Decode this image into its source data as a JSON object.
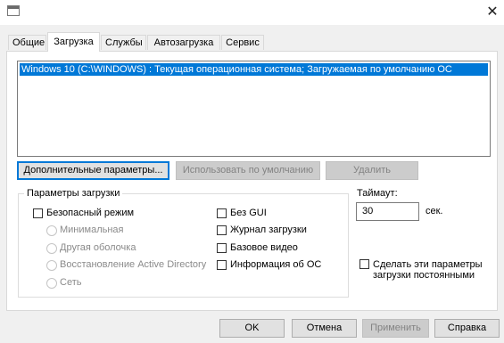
{
  "tabs": [
    {
      "label": "Общие"
    },
    {
      "label": "Загрузка"
    },
    {
      "label": "Службы"
    },
    {
      "label": "Автозагрузка"
    },
    {
      "label": "Сервис"
    }
  ],
  "active_tab": "Загрузка",
  "os_list": {
    "items": [
      "Windows 10 (C:\\WINDOWS) : Текущая операционная система; Загружаемая по умолчанию ОС"
    ],
    "selected_index": 0
  },
  "boot_buttons": {
    "advanced": "Дополнительные параметры...",
    "set_default": "Использовать по умолчанию",
    "delete": "Удалить"
  },
  "boot_options": {
    "title": "Параметры загрузки",
    "safe_boot": {
      "label": "Безопасный режим",
      "checked": false
    },
    "radios": [
      {
        "label": "Минимальная"
      },
      {
        "label": "Другая оболочка"
      },
      {
        "label": "Восстановление Active Directory"
      },
      {
        "label": "Сеть"
      }
    ],
    "checks": [
      {
        "label": "Без GUI",
        "checked": false
      },
      {
        "label": "Журнал загрузки",
        "checked": false
      },
      {
        "label": "Базовое видео",
        "checked": false
      },
      {
        "label": "Информация  об ОС",
        "checked": false
      }
    ]
  },
  "timeout": {
    "label": "Таймаут:",
    "value": "30",
    "unit": "сек."
  },
  "permanent": {
    "label_line1": "Сделать эти параметры",
    "label_line2": "загрузки постоянными",
    "checked": false
  },
  "dialog_buttons": {
    "ok": "OK",
    "cancel": "Отмена",
    "apply": "Применить",
    "help": "Справка"
  }
}
